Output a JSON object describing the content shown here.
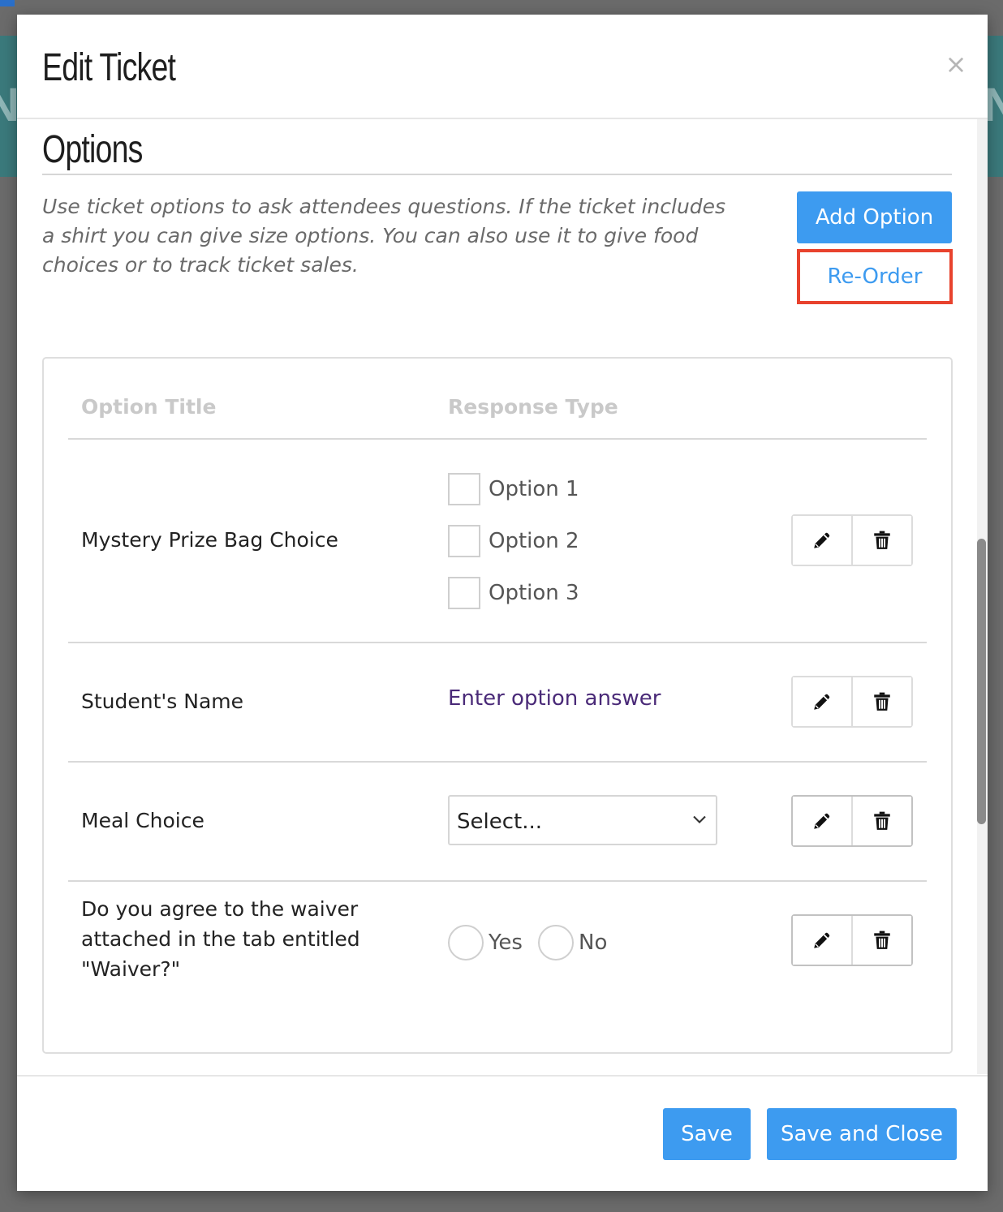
{
  "modal": {
    "title": "Edit Ticket",
    "close_label": "×"
  },
  "section": {
    "title": "Options",
    "help_text": "Use ticket options to ask attendees questions. If the ticket includes a shirt you can give size options. You can also use it to give food choices or to track ticket sales.",
    "add_option_label": "Add Option",
    "reorder_label": "Re-Order"
  },
  "table": {
    "headers": [
      "Option Title",
      "Response Type"
    ],
    "rows": [
      {
        "title": "Mystery Prize Bag Choice",
        "response_type": "checkbox",
        "choices": [
          "Option 1",
          "Option 2",
          "Option 3"
        ]
      },
      {
        "title": "Student's Name",
        "response_type": "text",
        "answer_text": "Enter option answer"
      },
      {
        "title": "Meal Choice",
        "response_type": "select",
        "selected": "Select..."
      },
      {
        "title": "Do you agree to the waiver attached in the tab entitled \"Waiver?\"",
        "response_type": "radio",
        "choices": [
          "Yes",
          "No"
        ]
      }
    ],
    "row_actions": [
      "pencil-icon",
      "trash-icon"
    ]
  },
  "footer": {
    "save_label": "Save",
    "save_close_label": "Save and Close"
  },
  "colors": {
    "primary": "#3d9bf0",
    "highlight_border": "#e8422d",
    "answer_text": "#4a2a78",
    "background_band": "#3b7a7c"
  }
}
